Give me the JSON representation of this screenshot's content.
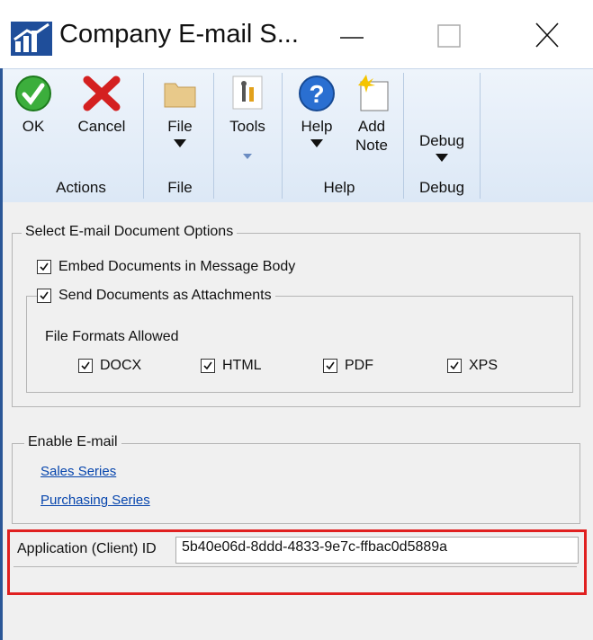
{
  "window": {
    "title": "Company E-mail S...",
    "controls": {
      "minimize": "—",
      "maximize": "☐",
      "close": "╳"
    }
  },
  "ribbon": {
    "buttons": {
      "ok": "OK",
      "cancel": "Cancel",
      "file": "File",
      "tools": "Tools",
      "help": "Help",
      "add_note_1": "Add",
      "add_note_2": "Note",
      "debug": "Debug"
    },
    "groups": {
      "actions": "Actions",
      "file": "File",
      "help": "Help",
      "debug": "Debug"
    }
  },
  "options": {
    "legend": "Select E-mail Document Options",
    "embed_label": "Embed Documents in Message Body",
    "embed_checked": true,
    "attach_label": "Send Documents as Attachments",
    "attach_checked": true,
    "formats_label": "File Formats Allowed",
    "formats": [
      {
        "label": "DOCX",
        "checked": true
      },
      {
        "label": "HTML",
        "checked": true
      },
      {
        "label": "PDF",
        "checked": true
      },
      {
        "label": "XPS",
        "checked": true
      }
    ]
  },
  "enable": {
    "legend": "Enable E-mail",
    "links": [
      "Sales Series",
      "Purchasing Series"
    ]
  },
  "client_id": {
    "label": "Application (Client) ID",
    "value": "5b40e06d-8ddd-4833-9e7c-ffbac0d5889a"
  },
  "colors": {
    "accent": "#2b5797",
    "highlight": "#e02020",
    "link": "#0645ad"
  }
}
